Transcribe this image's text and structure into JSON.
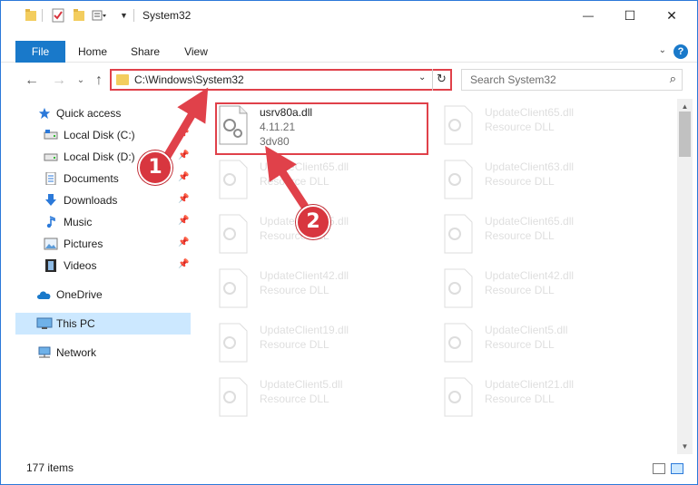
{
  "window": {
    "title": "System32",
    "controls": {
      "minimize": "—",
      "maximize": "☐",
      "close": "✕"
    }
  },
  "ribbon": {
    "tabs": [
      {
        "label": "File"
      },
      {
        "label": "Home"
      },
      {
        "label": "Share"
      },
      {
        "label": "View"
      }
    ],
    "help": "?"
  },
  "nav": {
    "back": "←",
    "forward": "→",
    "recent": "⌄",
    "up": "↑",
    "address": "C:\\Windows\\System32",
    "search_placeholder": "Search System32",
    "colors": {
      "annotation_red": "#e0414a"
    }
  },
  "sidebar": {
    "items": [
      {
        "label": "Quick access",
        "icon": "star-icon",
        "pinned": false
      },
      {
        "label": "Local Disk (C:)",
        "icon": "drive-icon",
        "pinned": true
      },
      {
        "label": "Local Disk (D:)",
        "icon": "drive-icon",
        "pinned": true
      },
      {
        "label": "Documents",
        "icon": "documents-icon",
        "pinned": true
      },
      {
        "label": "Downloads",
        "icon": "downloads-icon",
        "pinned": true
      },
      {
        "label": "Music",
        "icon": "music-icon",
        "pinned": true
      },
      {
        "label": "Pictures",
        "icon": "pictures-icon",
        "pinned": true
      },
      {
        "label": "Videos",
        "icon": "videos-icon",
        "pinned": true
      },
      {
        "label": "OneDrive",
        "icon": "cloud-icon",
        "pinned": false
      },
      {
        "label": "This PC",
        "icon": "computer-icon",
        "pinned": false,
        "selected": true
      },
      {
        "label": "Network",
        "icon": "network-icon",
        "pinned": false
      }
    ]
  },
  "files": {
    "focused": {
      "name": "usrv80a.dll",
      "version": "4.11.21",
      "description": "3dv80"
    },
    "left_column": [
      {
        "name": "UpdateClient65.dll",
        "type": "Resource DLL"
      },
      {
        "name": "UpdateClient15.dll",
        "type": "Resource DLL"
      },
      {
        "name": "UpdateClient42.dll",
        "type": "Resource DLL"
      },
      {
        "name": "UpdateClient19.dll",
        "type": "Resource DLL"
      },
      {
        "name": "UpdateClient5.dll",
        "type": "Resource DLL"
      }
    ],
    "right_column": [
      {
        "name": "UpdateClient65.dll",
        "type": "Resource DLL"
      },
      {
        "name": "UpdateClient63.dll",
        "type": "Resource DLL"
      },
      {
        "name": "UpdateClient65.dll",
        "type": "Resource DLL"
      },
      {
        "name": "UpdateClient42.dll",
        "type": "Resource DLL"
      },
      {
        "name": "UpdateClient5.dll",
        "type": "Resource DLL"
      },
      {
        "name": "UpdateClient21.dll",
        "type": "Resource DLL"
      }
    ]
  },
  "status": {
    "item_count": "177 items"
  },
  "annotations": {
    "step1": "1",
    "step2": "2"
  }
}
